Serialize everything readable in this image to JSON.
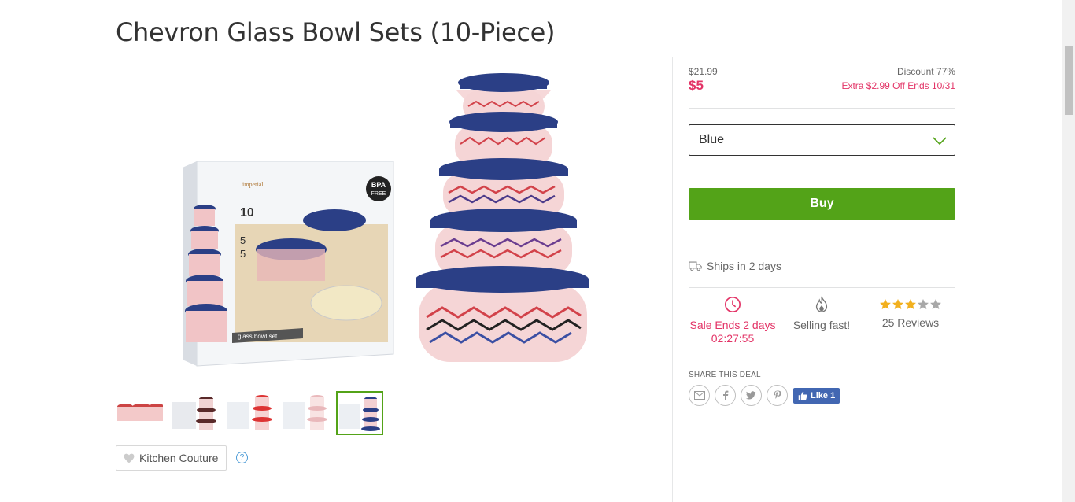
{
  "product": {
    "title": "Chevron Glass Bowl Sets (10-Piece)",
    "brand_label": "Kitchen Couture",
    "help_glyph": "?"
  },
  "pricing": {
    "original_price": "$21.99",
    "sale_price": "$5",
    "discount_text": "Discount 77%",
    "extra_offer": "Extra $2.99 Off Ends 10/31"
  },
  "option_select": {
    "selected_value": "Blue"
  },
  "buy_button": {
    "label": "Buy"
  },
  "shipping": {
    "text": "Ships in 2 days"
  },
  "stats": {
    "sale_ends_line1": "Sale Ends 2 days",
    "sale_ends_line2": "02:27:55",
    "selling_label": "Selling fast!",
    "rating_value": 3,
    "rating_max": 5,
    "reviews_label": "25 Reviews"
  },
  "share": {
    "label": "SHARE THIS DEAL",
    "icons": [
      "email-icon",
      "facebook-icon",
      "twitter-icon",
      "pinterest-icon"
    ],
    "fb_like_label": "Like 1"
  },
  "colors": {
    "accent_pink": "#e33467",
    "buy_green": "#53a318",
    "lid_blue": "#2b3f86",
    "star_gold": "#f2b01e",
    "fb_blue": "#4267b2"
  }
}
